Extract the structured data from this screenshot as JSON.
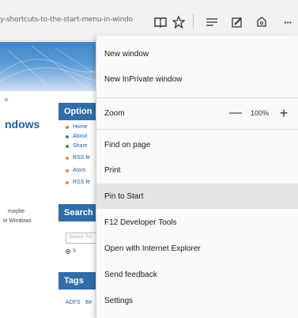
{
  "browser": {
    "address_text": "y-shortcuts-to-the-start-menu-in-windo",
    "icons": {
      "reading_view": "book-icon",
      "favorites": "star-icon",
      "hub": "hub-lines-icon",
      "web_note": "pen-square-icon",
      "share": "share-icon",
      "more": "more-dots-icon"
    },
    "more_label": "···"
  },
  "page": {
    "left_link": "o",
    "site_title": "ndows",
    "left_texts": [
      "maybe",
      "in Windows"
    ],
    "options_header": "Option",
    "options": [
      {
        "label": "Home",
        "color": "#e07b2a"
      },
      {
        "label": "About",
        "color": "#3a7fd0"
      },
      {
        "label": "Share",
        "color": "#3a9a3a"
      },
      {
        "label": "RSS fe",
        "color": "#f08a2a"
      },
      {
        "label": "Atom",
        "color": "#f08a2a"
      },
      {
        "label": "RSS fe",
        "color": "#f08a2a"
      }
    ],
    "search_header": "Search",
    "search_placeholder": "Search Thi",
    "search_radio_label": "S",
    "tags_header": "Tags",
    "tags": [
      "ADFS",
      "Be"
    ]
  },
  "menu": {
    "new_window": "New window",
    "new_inprivate": "New InPrivate window",
    "zoom_label": "Zoom",
    "zoom_minus": "—",
    "zoom_value": "100%",
    "zoom_plus": "+",
    "find_on_page": "Find on page",
    "print": "Print",
    "pin_to_start": "Pin to Start",
    "f12_tools": "F12 Developer Tools",
    "open_ie": "Open with Internet Explorer",
    "send_feedback": "Send feedback",
    "settings": "Settings",
    "hovered_item": "Pin to Start"
  },
  "colors": {
    "menu_bg": "#f9f9f9",
    "menu_hover": "#e4e4e4",
    "panel_header": "#2f6ea8",
    "link": "#1f5fa8"
  }
}
